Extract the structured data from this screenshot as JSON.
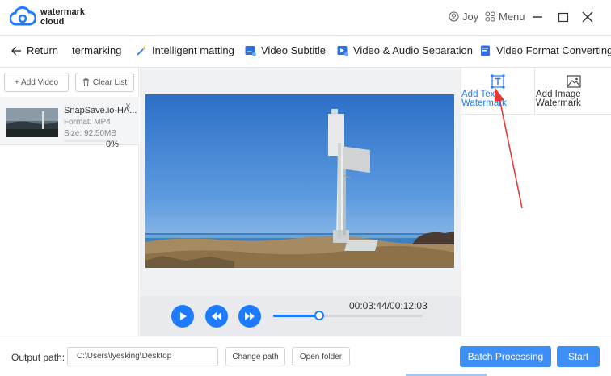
{
  "app": {
    "brand_line1": "watermark",
    "brand_line2": "cloud"
  },
  "header": {
    "user_name": "Joy",
    "menu_label": "Menu"
  },
  "nav": {
    "return_label": "Return",
    "items": [
      "termarking",
      "Intelligent matting",
      "Video Subtitle",
      "Video & Audio Separation",
      "Video Format Converting"
    ]
  },
  "file_panel": {
    "add_video_label": "+ Add Video",
    "clear_list_label": "Clear List",
    "file": {
      "name": "SnapSave.io-HA...",
      "format": "Format:  MP4",
      "size": "Size:  92.50MB",
      "progress_text": "0%",
      "progress": 0
    }
  },
  "player": {
    "time": "00:03:44/00:12:03",
    "position_fraction": 0.31
  },
  "watermark_panel": {
    "add_text_line1": "Add Text",
    "add_text_line2": "Watermark",
    "add_image_line1": "Add Image",
    "add_image_line2": "Watermark"
  },
  "footer": {
    "output_label": "Output path:",
    "output_path": "C:\\Users\\lyesking\\Desktop",
    "change_path_label": "Change path",
    "open_folder_label": "Open folder",
    "batch_label": "Batch Processing",
    "start_label": "Start"
  },
  "colors": {
    "accent": "#1e7bff",
    "primary_button": "#3d8ef7",
    "annotation_arrow": "#e53935"
  }
}
